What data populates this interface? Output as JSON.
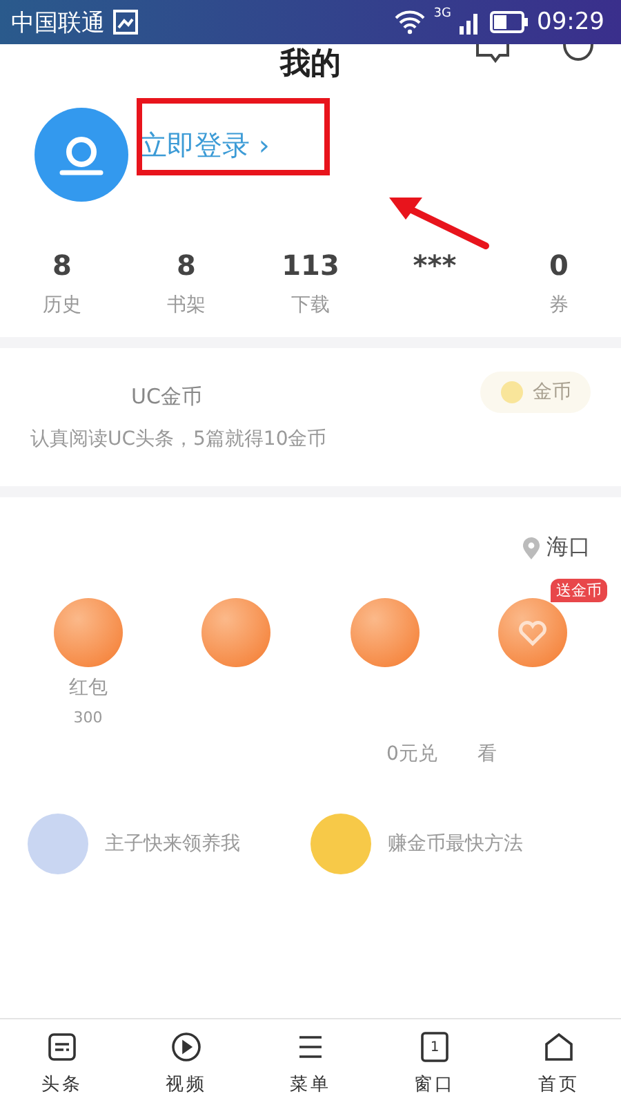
{
  "status_bar": {
    "carrier": "中国联通",
    "network": "3G",
    "time": "09:29"
  },
  "header": {
    "title": "我的"
  },
  "profile": {
    "login": "立即登录",
    "chevron": "›",
    "annotated": true
  },
  "stats": [
    {
      "value": "8",
      "label": "历史"
    },
    {
      "value": "8",
      "label": "书架"
    },
    {
      "value": "113",
      "label": "下载"
    },
    {
      "value": "***"
    },
    {
      "value": "0",
      "label": "券"
    }
  ],
  "coin_card": {
    "title": "UC金币",
    "subtitle": "认真阅读UC头条，5篇就得10金币",
    "action": "金币"
  },
  "location": "海口",
  "tasks": [
    {
      "kind": "plain",
      "label": "红包",
      "sub": "300"
    },
    {
      "kind": "plain"
    },
    {
      "kind": "plain"
    },
    {
      "kind": "heart",
      "badge": "送金币"
    }
  ],
  "promos": [
    {
      "text": "0元兑"
    },
    {
      "text": "看"
    }
  ],
  "features": [
    {
      "text": "主子快来领养我",
      "color": "#c9d6f2"
    },
    {
      "text": "赚金币最快方法",
      "color": "#f7c948"
    }
  ],
  "nav": [
    {
      "label": "头条",
      "kind": "news"
    },
    {
      "label": "视频",
      "kind": "video"
    },
    {
      "label": "菜单",
      "kind": "menu"
    },
    {
      "label": "窗口",
      "kind": "window",
      "count": "1"
    },
    {
      "label": "首页",
      "kind": "home"
    }
  ]
}
